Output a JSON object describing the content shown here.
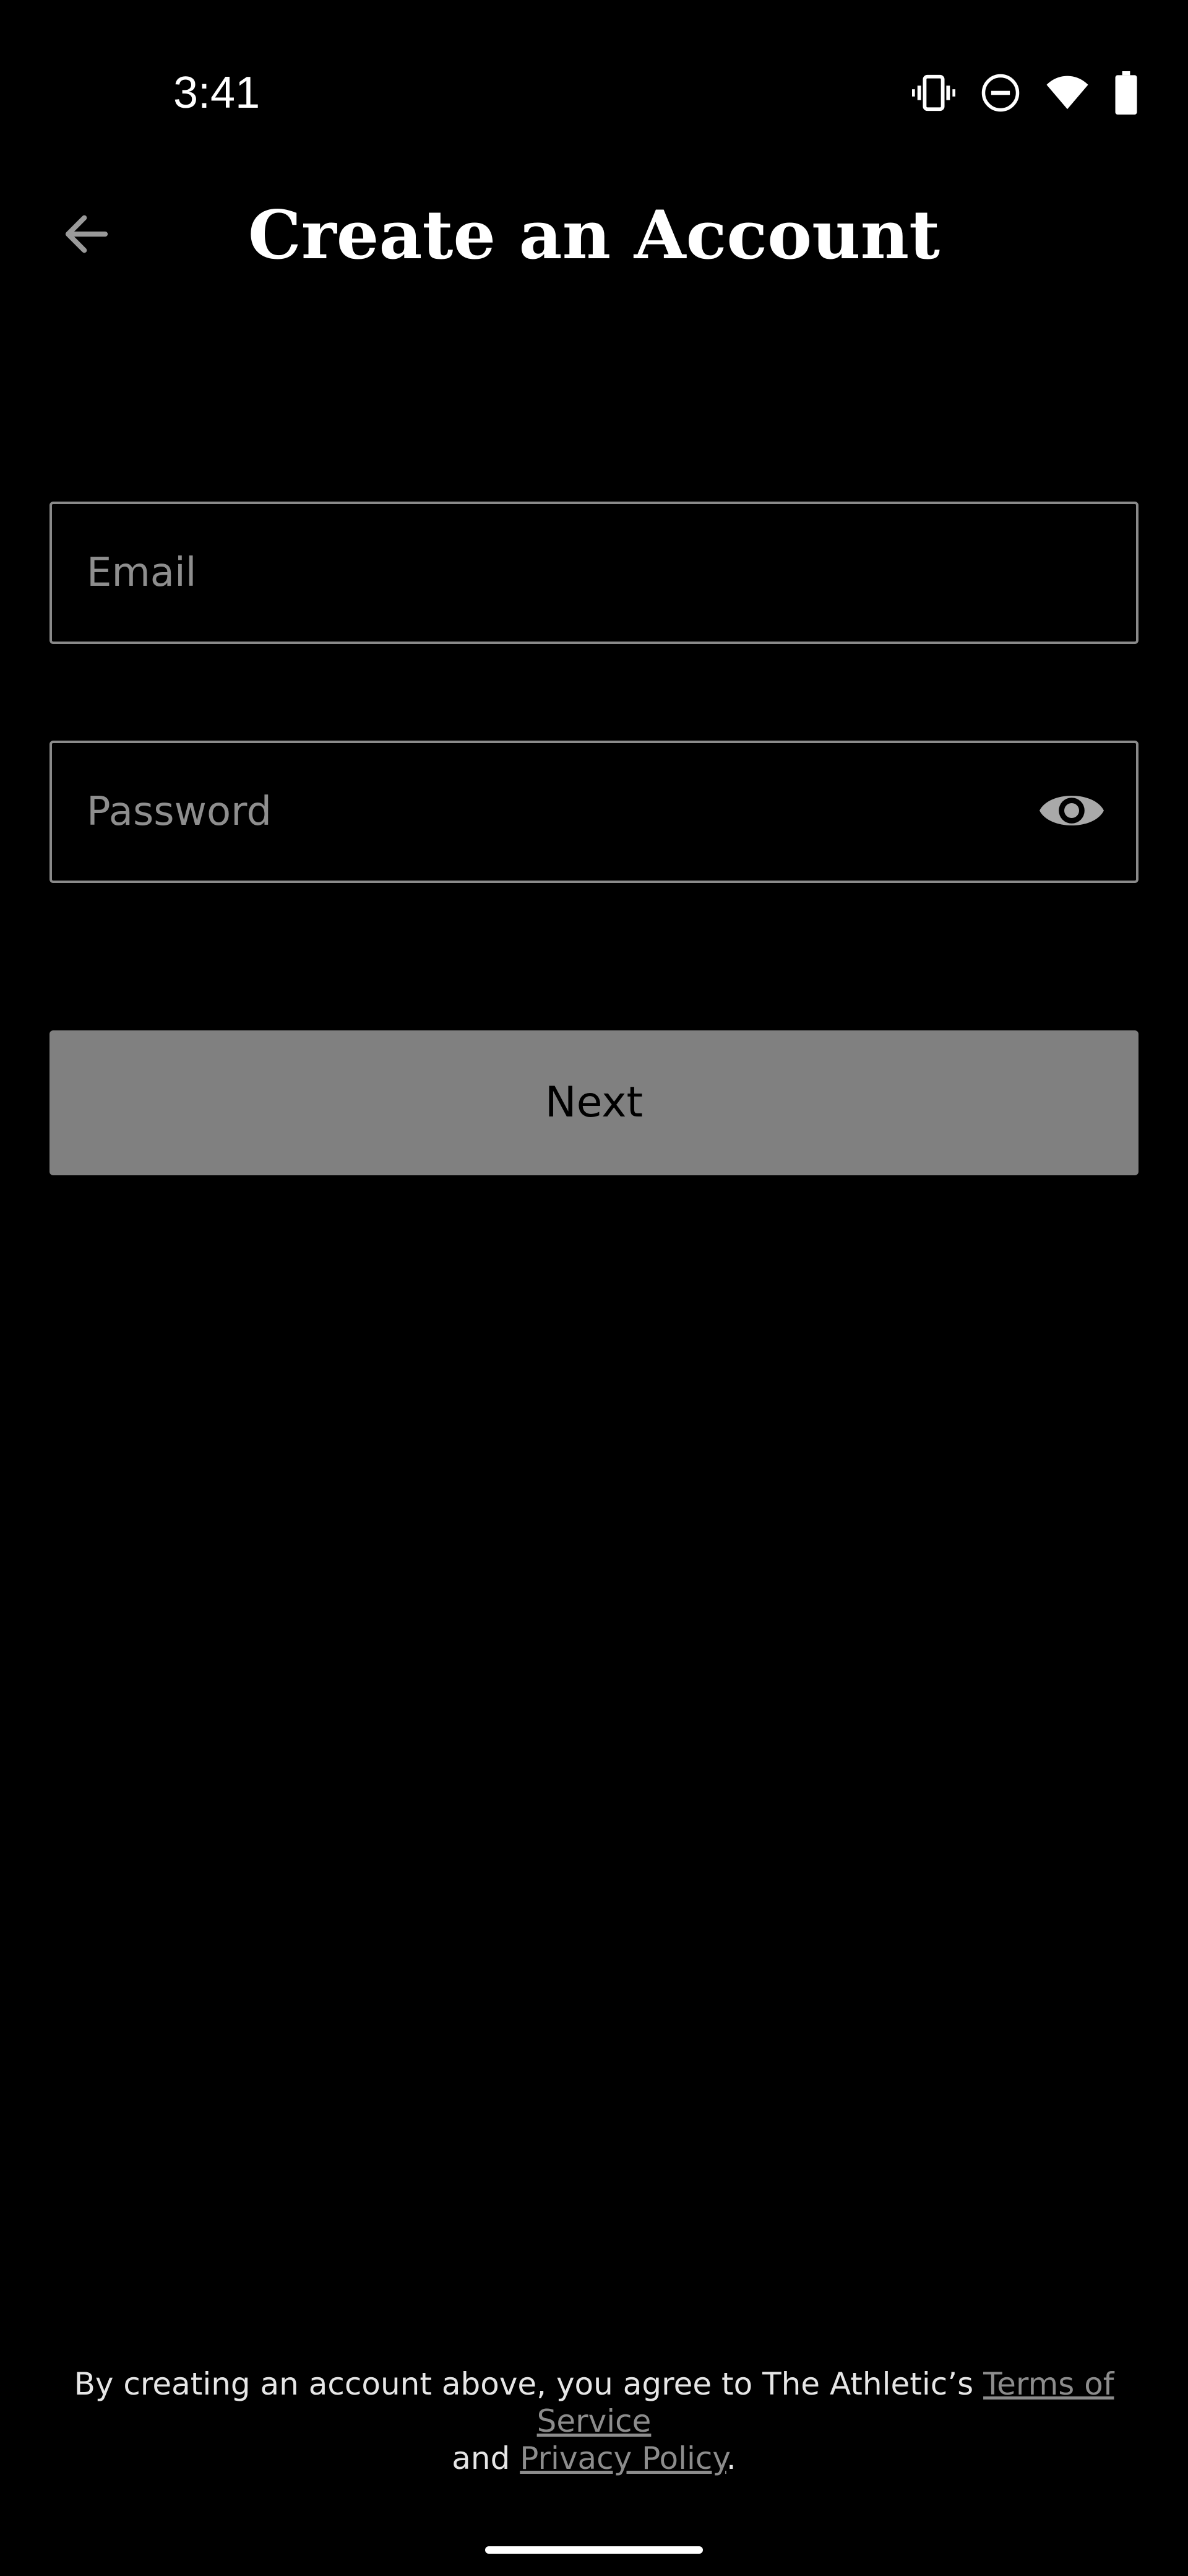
{
  "status_bar": {
    "time": "3:41",
    "icons": [
      "vibrate-icon",
      "do-not-disturb-icon",
      "wifi-icon",
      "battery-icon"
    ]
  },
  "app_bar": {
    "back_icon": "arrow-left-icon",
    "title": "Create an Account"
  },
  "form": {
    "email": {
      "placeholder": "Email",
      "value": ""
    },
    "password": {
      "placeholder": "Password",
      "value": "",
      "toggle_icon": "eye-icon"
    },
    "next_label": "Next"
  },
  "legal": {
    "prefix": "By creating an account above, you agree to The Athletic’s",
    "terms_label": "Terms of Service",
    "and_text": "and",
    "privacy_label": "Privacy Policy",
    "suffix": "."
  },
  "colors": {
    "background": "#000000",
    "button_disabled": "#808080",
    "field_border": "#8a8a8a",
    "placeholder": "#8e8e8e",
    "link": "#8c8c8c"
  }
}
